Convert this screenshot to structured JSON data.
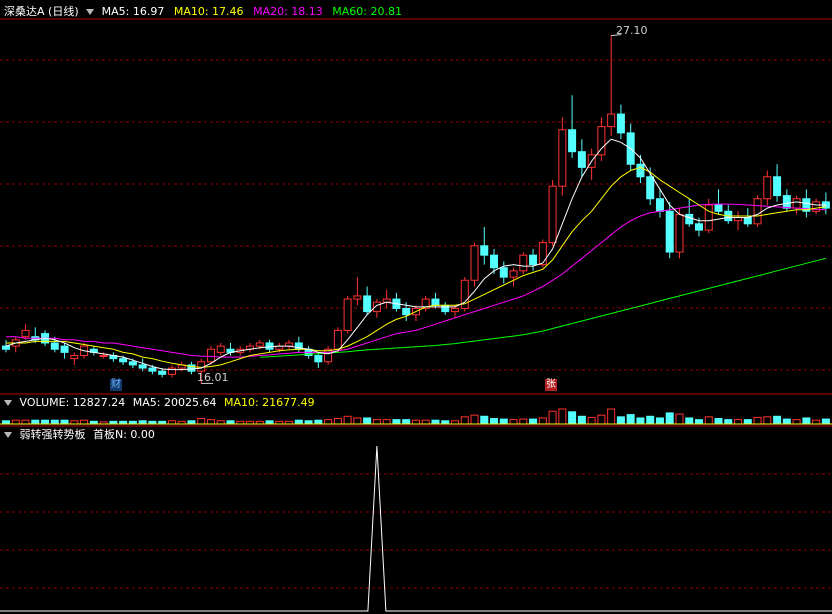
{
  "price_panel": {
    "stock_name": "深桑达A",
    "period": "(日线)",
    "ma_values": [
      {
        "label": "MA5: 16.97",
        "color": "#ffffff"
      },
      {
        "label": "MA10: 17.46",
        "color": "#ffff00"
      },
      {
        "label": "MA20: 18.13",
        "color": "#ff00ff"
      },
      {
        "label": "MA60: 20.81",
        "color": "#00ff00"
      }
    ],
    "high_label": "27.10",
    "low_label": "16.01",
    "marker_cai": "财",
    "marker_zhang": "张"
  },
  "volume_panel": {
    "label": "VOLUME: 12827.24",
    "ma5": "MA5: 20025.64",
    "ma10": "MA10: 21677.49"
  },
  "indicator_panel": {
    "name": "弱转强转势板",
    "param": "首板N: 0.00"
  },
  "colors": {
    "up": "#ff3232",
    "down": "#54ffff",
    "ma5": "#ffffff",
    "ma10": "#ffff00",
    "ma20": "#ff00ff",
    "ma60": "#00ff00",
    "grid": "#8b0000",
    "border": "#b40000"
  },
  "chart_data": {
    "type": "candlestick",
    "ohlc": [
      [
        17.2,
        17.4,
        17.0,
        17.1
      ],
      [
        17.2,
        17.5,
        17.0,
        17.4
      ],
      [
        17.5,
        17.9,
        17.4,
        17.7
      ],
      [
        17.5,
        17.8,
        17.3,
        17.4
      ],
      [
        17.6,
        17.7,
        17.2,
        17.3
      ],
      [
        17.3,
        17.5,
        17.0,
        17.1
      ],
      [
        17.2,
        17.3,
        16.8,
        17.0
      ],
      [
        16.8,
        17.0,
        16.6,
        16.9
      ],
      [
        16.9,
        17.3,
        16.8,
        17.2
      ],
      [
        17.1,
        17.2,
        16.9,
        17.0
      ],
      [
        16.9,
        17.0,
        16.8,
        16.9
      ],
      [
        16.9,
        17.0,
        16.7,
        16.8
      ],
      [
        16.8,
        16.9,
        16.6,
        16.7
      ],
      [
        16.7,
        16.8,
        16.5,
        16.6
      ],
      [
        16.6,
        16.8,
        16.4,
        16.5
      ],
      [
        16.5,
        16.6,
        16.3,
        16.4
      ],
      [
        16.4,
        16.5,
        16.2,
        16.3
      ],
      [
        16.3,
        16.6,
        16.2,
        16.5
      ],
      [
        16.5,
        16.7,
        16.4,
        16.6
      ],
      [
        16.6,
        16.7,
        16.3,
        16.4
      ],
      [
        16.4,
        16.8,
        16.0,
        16.7
      ],
      [
        16.7,
        17.2,
        16.6,
        17.1
      ],
      [
        17.0,
        17.3,
        16.9,
        17.2
      ],
      [
        17.1,
        17.3,
        16.9,
        17.0
      ],
      [
        17.0,
        17.2,
        16.9,
        17.1
      ],
      [
        17.1,
        17.3,
        17.0,
        17.2
      ],
      [
        17.2,
        17.4,
        17.1,
        17.3
      ],
      [
        17.3,
        17.4,
        17.0,
        17.1
      ],
      [
        17.1,
        17.3,
        17.0,
        17.2
      ],
      [
        17.2,
        17.4,
        17.1,
        17.3
      ],
      [
        17.3,
        17.5,
        17.0,
        17.1
      ],
      [
        17.1,
        17.2,
        16.8,
        16.9
      ],
      [
        16.9,
        17.0,
        16.5,
        16.7
      ],
      [
        16.7,
        17.2,
        16.6,
        17.1
      ],
      [
        17.1,
        17.8,
        17.0,
        17.7
      ],
      [
        17.7,
        18.8,
        17.6,
        18.7
      ],
      [
        18.7,
        19.4,
        18.5,
        18.8
      ],
      [
        18.8,
        19.1,
        18.2,
        18.3
      ],
      [
        18.3,
        18.7,
        18.1,
        18.6
      ],
      [
        18.6,
        19.0,
        18.4,
        18.7
      ],
      [
        18.7,
        18.9,
        18.3,
        18.4
      ],
      [
        18.4,
        18.6,
        18.0,
        18.2
      ],
      [
        18.2,
        18.5,
        18.0,
        18.4
      ],
      [
        18.4,
        18.8,
        18.3,
        18.7
      ],
      [
        18.7,
        18.9,
        18.4,
        18.5
      ],
      [
        18.5,
        18.6,
        18.2,
        18.3
      ],
      [
        18.3,
        18.5,
        18.1,
        18.4
      ],
      [
        18.4,
        19.4,
        18.3,
        19.3
      ],
      [
        19.3,
        20.5,
        19.1,
        20.4
      ],
      [
        20.4,
        21.0,
        19.8,
        20.1
      ],
      [
        20.1,
        20.3,
        19.5,
        19.7
      ],
      [
        19.7,
        19.9,
        19.2,
        19.4
      ],
      [
        19.4,
        19.7,
        19.1,
        19.6
      ],
      [
        19.6,
        20.2,
        19.5,
        20.1
      ],
      [
        20.1,
        20.3,
        19.6,
        19.8
      ],
      [
        19.8,
        20.6,
        19.7,
        20.5
      ],
      [
        20.5,
        22.5,
        20.4,
        22.3
      ],
      [
        22.3,
        24.5,
        22.0,
        24.1
      ],
      [
        24.1,
        25.2,
        23.2,
        23.4
      ],
      [
        23.4,
        23.8,
        22.6,
        22.9
      ],
      [
        22.9,
        23.5,
        22.5,
        23.3
      ],
      [
        23.3,
        24.5,
        23.1,
        24.2
      ],
      [
        24.2,
        27.1,
        23.9,
        24.6
      ],
      [
        24.6,
        24.9,
        23.8,
        24.0
      ],
      [
        24.0,
        24.3,
        22.8,
        23.0
      ],
      [
        23.0,
        23.3,
        22.4,
        22.6
      ],
      [
        22.6,
        22.9,
        21.7,
        21.9
      ],
      [
        21.9,
        22.2,
        21.3,
        21.5
      ],
      [
        21.5,
        21.8,
        20.0,
        20.2
      ],
      [
        20.2,
        21.6,
        20.0,
        21.4
      ],
      [
        21.4,
        21.9,
        21.0,
        21.1
      ],
      [
        21.1,
        21.3,
        20.7,
        20.9
      ],
      [
        20.9,
        21.9,
        20.8,
        21.7
      ],
      [
        21.7,
        22.2,
        21.4,
        21.5
      ],
      [
        21.5,
        21.7,
        21.1,
        21.2
      ],
      [
        21.2,
        21.5,
        20.9,
        21.3
      ],
      [
        21.3,
        21.6,
        21.0,
        21.1
      ],
      [
        21.1,
        22.0,
        21.0,
        21.9
      ],
      [
        21.9,
        22.8,
        21.7,
        22.6
      ],
      [
        22.6,
        23.0,
        21.8,
        22.0
      ],
      [
        22.0,
        22.2,
        21.5,
        21.6
      ],
      [
        21.6,
        22.0,
        21.4,
        21.9
      ],
      [
        21.9,
        22.2,
        21.3,
        21.5
      ],
      [
        21.5,
        21.9,
        21.4,
        21.8
      ],
      [
        21.8,
        22.1,
        21.4,
        21.6
      ]
    ],
    "ma5": [
      17.2,
      17.3,
      17.35,
      17.4,
      17.45,
      17.4,
      17.3,
      17.15,
      17.05,
      17.0,
      16.95,
      16.9,
      16.85,
      16.75,
      16.65,
      16.55,
      16.47,
      16.45,
      16.45,
      16.47,
      16.5,
      16.65,
      16.85,
      17.0,
      17.05,
      17.1,
      17.15,
      17.18,
      17.2,
      17.2,
      17.15,
      17.1,
      17.0,
      16.95,
      17.05,
      17.4,
      17.8,
      18.2,
      18.5,
      18.6,
      18.55,
      18.5,
      18.45,
      18.45,
      18.45,
      18.45,
      18.45,
      18.6,
      18.95,
      19.35,
      19.6,
      19.75,
      19.8,
      19.75,
      19.75,
      19.85,
      20.3,
      21.1,
      21.9,
      22.6,
      23.1,
      23.5,
      23.8,
      23.7,
      23.5,
      23.2,
      22.7,
      22.2,
      21.7,
      21.4,
      21.3,
      21.2,
      21.2,
      21.25,
      21.3,
      21.3,
      21.3,
      21.4,
      21.6,
      21.7,
      21.75,
      21.8,
      21.75,
      21.7,
      21.7
    ],
    "ma10": [
      17.3,
      17.3,
      17.3,
      17.35,
      17.35,
      17.35,
      17.35,
      17.3,
      17.25,
      17.2,
      17.15,
      17.1,
      17.0,
      16.95,
      16.85,
      16.8,
      16.72,
      16.65,
      16.6,
      16.55,
      16.52,
      16.55,
      16.6,
      16.7,
      16.8,
      16.9,
      16.95,
      17.0,
      17.05,
      17.08,
      17.1,
      17.1,
      17.05,
      17.05,
      17.1,
      17.2,
      17.35,
      17.5,
      17.7,
      17.9,
      18.05,
      18.15,
      18.3,
      18.45,
      18.5,
      18.5,
      18.5,
      18.55,
      18.7,
      18.85,
      19.0,
      19.15,
      19.3,
      19.45,
      19.55,
      19.65,
      19.95,
      20.4,
      20.85,
      21.2,
      21.5,
      21.9,
      22.3,
      22.6,
      22.8,
      22.9,
      22.75,
      22.5,
      22.3,
      22.1,
      21.9,
      21.7,
      21.5,
      21.4,
      21.35,
      21.35,
      21.35,
      21.35,
      21.4,
      21.45,
      21.5,
      21.55,
      21.55,
      21.6,
      21.65
    ],
    "ma20": [
      17.5,
      17.5,
      17.45,
      17.45,
      17.45,
      17.45,
      17.4,
      17.4,
      17.35,
      17.35,
      17.3,
      17.3,
      17.25,
      17.2,
      17.15,
      17.1,
      17.05,
      17.0,
      16.95,
      16.9,
      16.88,
      16.87,
      16.85,
      16.85,
      16.85,
      16.87,
      16.9,
      16.92,
      16.95,
      16.97,
      17.0,
      17.0,
      17.0,
      17.0,
      17.05,
      17.1,
      17.2,
      17.3,
      17.4,
      17.5,
      17.6,
      17.65,
      17.7,
      17.8,
      17.9,
      18.0,
      18.1,
      18.2,
      18.3,
      18.4,
      18.5,
      18.6,
      18.7,
      18.8,
      18.95,
      19.1,
      19.3,
      19.5,
      19.75,
      20.0,
      20.25,
      20.5,
      20.75,
      21.0,
      21.2,
      21.35,
      21.45,
      21.5,
      21.55,
      21.6,
      21.65,
      21.7,
      21.72,
      21.73,
      21.73,
      21.72,
      21.7,
      21.68,
      21.66,
      21.64,
      21.62,
      21.6,
      21.58,
      21.56,
      21.55
    ],
    "ma60": [
      null,
      null,
      null,
      null,
      null,
      null,
      null,
      null,
      null,
      null,
      null,
      null,
      null,
      null,
      null,
      null,
      null,
      null,
      null,
      null,
      null,
      null,
      null,
      null,
      null,
      null,
      16.85,
      16.86,
      16.88,
      16.9,
      16.92,
      16.94,
      16.96,
      16.98,
      17.0,
      17.02,
      17.05,
      17.08,
      17.1,
      17.12,
      17.14,
      17.16,
      17.18,
      17.2,
      17.22,
      17.25,
      17.28,
      17.32,
      17.36,
      17.4,
      17.44,
      17.48,
      17.52,
      17.56,
      17.62,
      17.68,
      17.76,
      17.84,
      17.92,
      18.0,
      18.08,
      18.16,
      18.24,
      18.32,
      18.4,
      18.48,
      18.56,
      18.64,
      18.72,
      18.8,
      18.88,
      18.96,
      19.04,
      19.12,
      19.2,
      19.28,
      19.36,
      19.44,
      19.52,
      19.6,
      19.68,
      19.76,
      19.84,
      19.92,
      20.0
    ],
    "indicator_signal_index": 38
  }
}
